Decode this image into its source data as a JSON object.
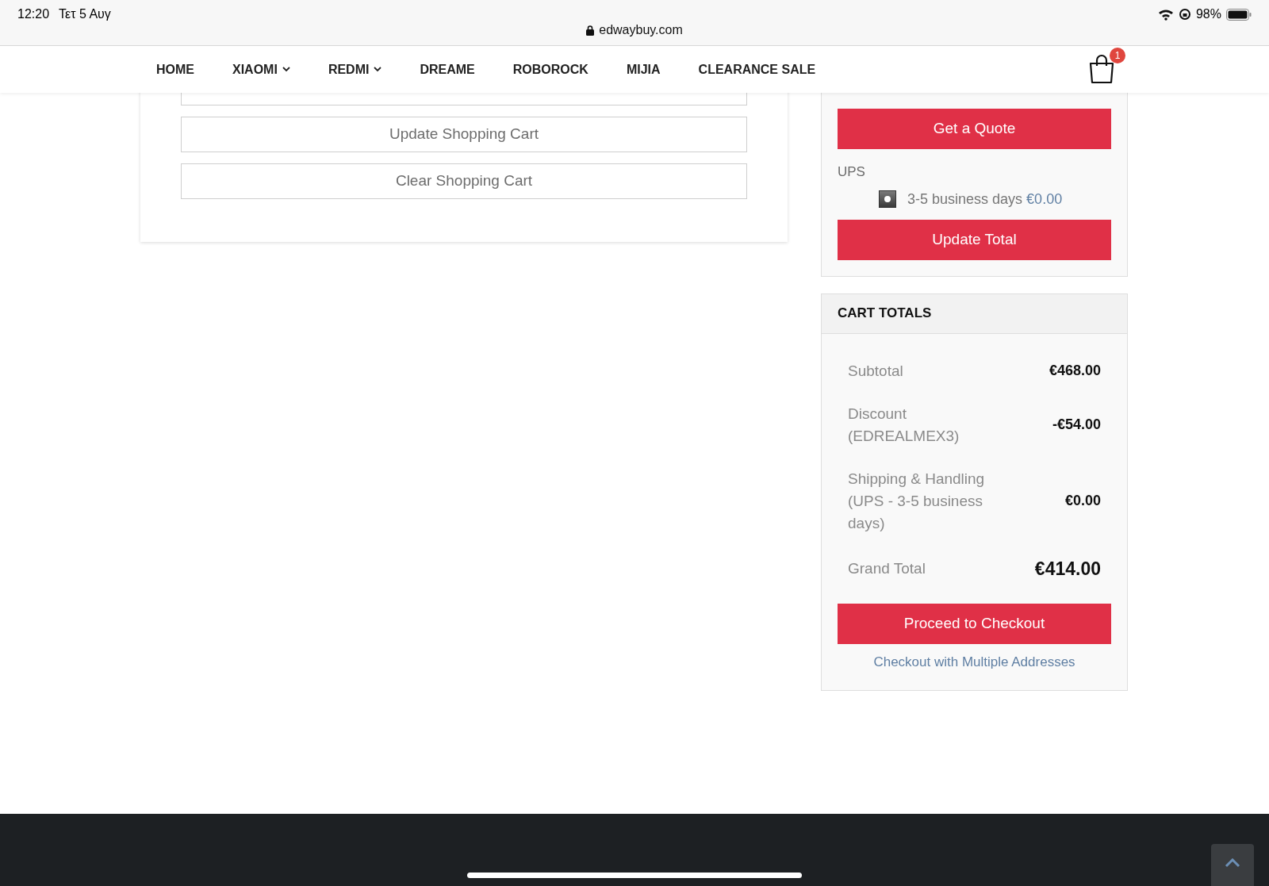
{
  "status_bar": {
    "time": "12:20",
    "date": "Τετ 5 Αυγ",
    "url": "edwaybuy.com",
    "battery": "98%"
  },
  "nav": {
    "items": [
      {
        "label": "HOME",
        "dropdown": false
      },
      {
        "label": "XIAOMI",
        "dropdown": true
      },
      {
        "label": "REDMI",
        "dropdown": true
      },
      {
        "label": "DREAME",
        "dropdown": false
      },
      {
        "label": "ROBOROCK",
        "dropdown": false
      },
      {
        "label": "MIJIA",
        "dropdown": false
      },
      {
        "label": "CLEARANCE SALE",
        "dropdown": false
      }
    ],
    "cart_count": "1"
  },
  "cart_actions": [
    "Update Shopping Cart",
    "Clear Shopping Cart"
  ],
  "shipping": {
    "quote_button": "Get a Quote",
    "carrier": "UPS",
    "options": [
      {
        "label": "3-5 business days",
        "price": "€0.00",
        "selected": true
      }
    ],
    "update_button": "Update Total"
  },
  "cart_totals": {
    "title": "CART TOTALS",
    "rows": [
      {
        "label": "Subtotal",
        "value": "€468.00",
        "grand": false
      },
      {
        "label": "Discount (EDREALMEX3)",
        "value": "-€54.00",
        "grand": false
      },
      {
        "label": "Shipping & Handling (UPS - 3-5 business days)",
        "value": "€0.00",
        "grand": false
      },
      {
        "label": "Grand Total",
        "value": "€414.00",
        "grand": true
      }
    ],
    "checkout_button": "Proceed to Checkout",
    "multi_address_link": "Checkout with Multiple Addresses"
  }
}
